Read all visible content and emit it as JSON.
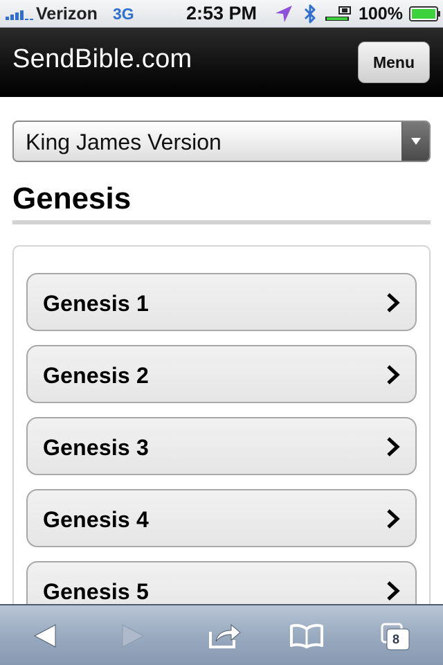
{
  "status_bar": {
    "carrier": "Verizon",
    "network": "3G",
    "time": "2:53 PM",
    "battery_percent": "100%",
    "icons": [
      "signal-bars-icon",
      "location-arrow-icon",
      "bluetooth-icon",
      "orientation-lock-icon",
      "battery-icon"
    ]
  },
  "header": {
    "brand": "SendBible.com",
    "menu_label": "Menu"
  },
  "version_select": {
    "selected": "King James Version",
    "icon": "dropdown-arrow-icon"
  },
  "book": {
    "title": "Genesis"
  },
  "chapters": [
    {
      "label": "Genesis 1"
    },
    {
      "label": "Genesis 2"
    },
    {
      "label": "Genesis 3"
    },
    {
      "label": "Genesis 4"
    },
    {
      "label": "Genesis 5"
    }
  ],
  "toolbar": {
    "tab_count": "8",
    "icons": [
      "back-arrow-icon",
      "forward-arrow-icon",
      "share-icon",
      "bookmarks-icon",
      "tabs-icon"
    ]
  },
  "colors": {
    "header_bg": "#000000",
    "toolbar_bg": "#9aabc0",
    "network_blue": "#2f6fd0",
    "battery_green": "#3bd23b"
  }
}
